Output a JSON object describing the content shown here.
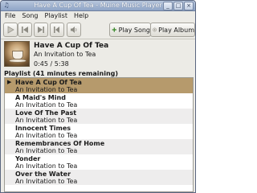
{
  "window": {
    "title": "Have A Cup Of Tea - Muine Music Player"
  },
  "menu": [
    "File",
    "Song",
    "Playlist",
    "Help"
  ],
  "toolbar": {
    "play_song": "Play Song",
    "play_album": "Play Album"
  },
  "now_playing": {
    "title": "Have A Cup Of Tea",
    "album": "An Invitation to Tea",
    "time": "0:45 / 5:38"
  },
  "playlist": {
    "header": "Playlist (41 minutes remaining)",
    "rows": [
      {
        "title": "Have A Cup Of Tea",
        "album": "An Invitation to Tea"
      },
      {
        "title": "A Maid's Mind",
        "album": "An Invitation to Tea"
      },
      {
        "title": "Love Of The Past",
        "album": "An Invitation to Tea"
      },
      {
        "title": "Innocent Times",
        "album": "An Invitation to Tea"
      },
      {
        "title": "Remembrances Of Home",
        "album": "An Invitation to Tea"
      },
      {
        "title": "Yonder",
        "album": "An Invitation to Tea"
      },
      {
        "title": "Over the Water",
        "album": "An Invitation to Tea"
      }
    ]
  },
  "colors": {
    "selected_row": "#b69a6c",
    "titlebar": "#8ea4c6"
  }
}
